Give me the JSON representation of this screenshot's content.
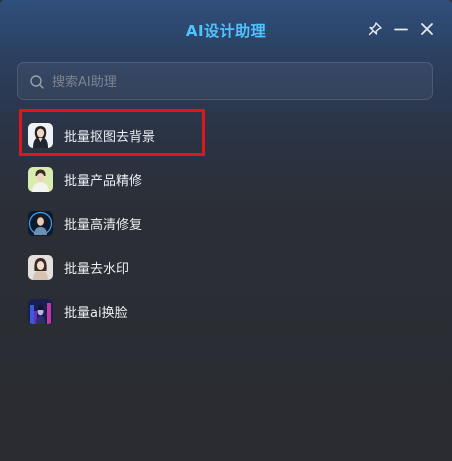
{
  "window": {
    "title": "AI设计助理"
  },
  "titlebar": {
    "pin_icon": "pin-icon",
    "minimize_icon": "minimize-icon",
    "close_icon": "close-icon"
  },
  "search": {
    "placeholder": "搜索AI助理",
    "value": "",
    "icon": "search-icon"
  },
  "items": [
    {
      "label": "批量抠图去背景",
      "icon": "avatar-woman-white-background",
      "highlighted": true
    },
    {
      "label": "批量产品精修",
      "icon": "avatar-man-light-green"
    },
    {
      "label": "批量高清修复",
      "icon": "avatar-woman-dark-blue"
    },
    {
      "label": "批量去水印",
      "icon": "avatar-woman-light"
    },
    {
      "label": "批量ai换脸",
      "icon": "avatar-neon-city"
    }
  ],
  "colors": {
    "title": "#4fc3ff",
    "highlight_border": "#e0161c"
  }
}
